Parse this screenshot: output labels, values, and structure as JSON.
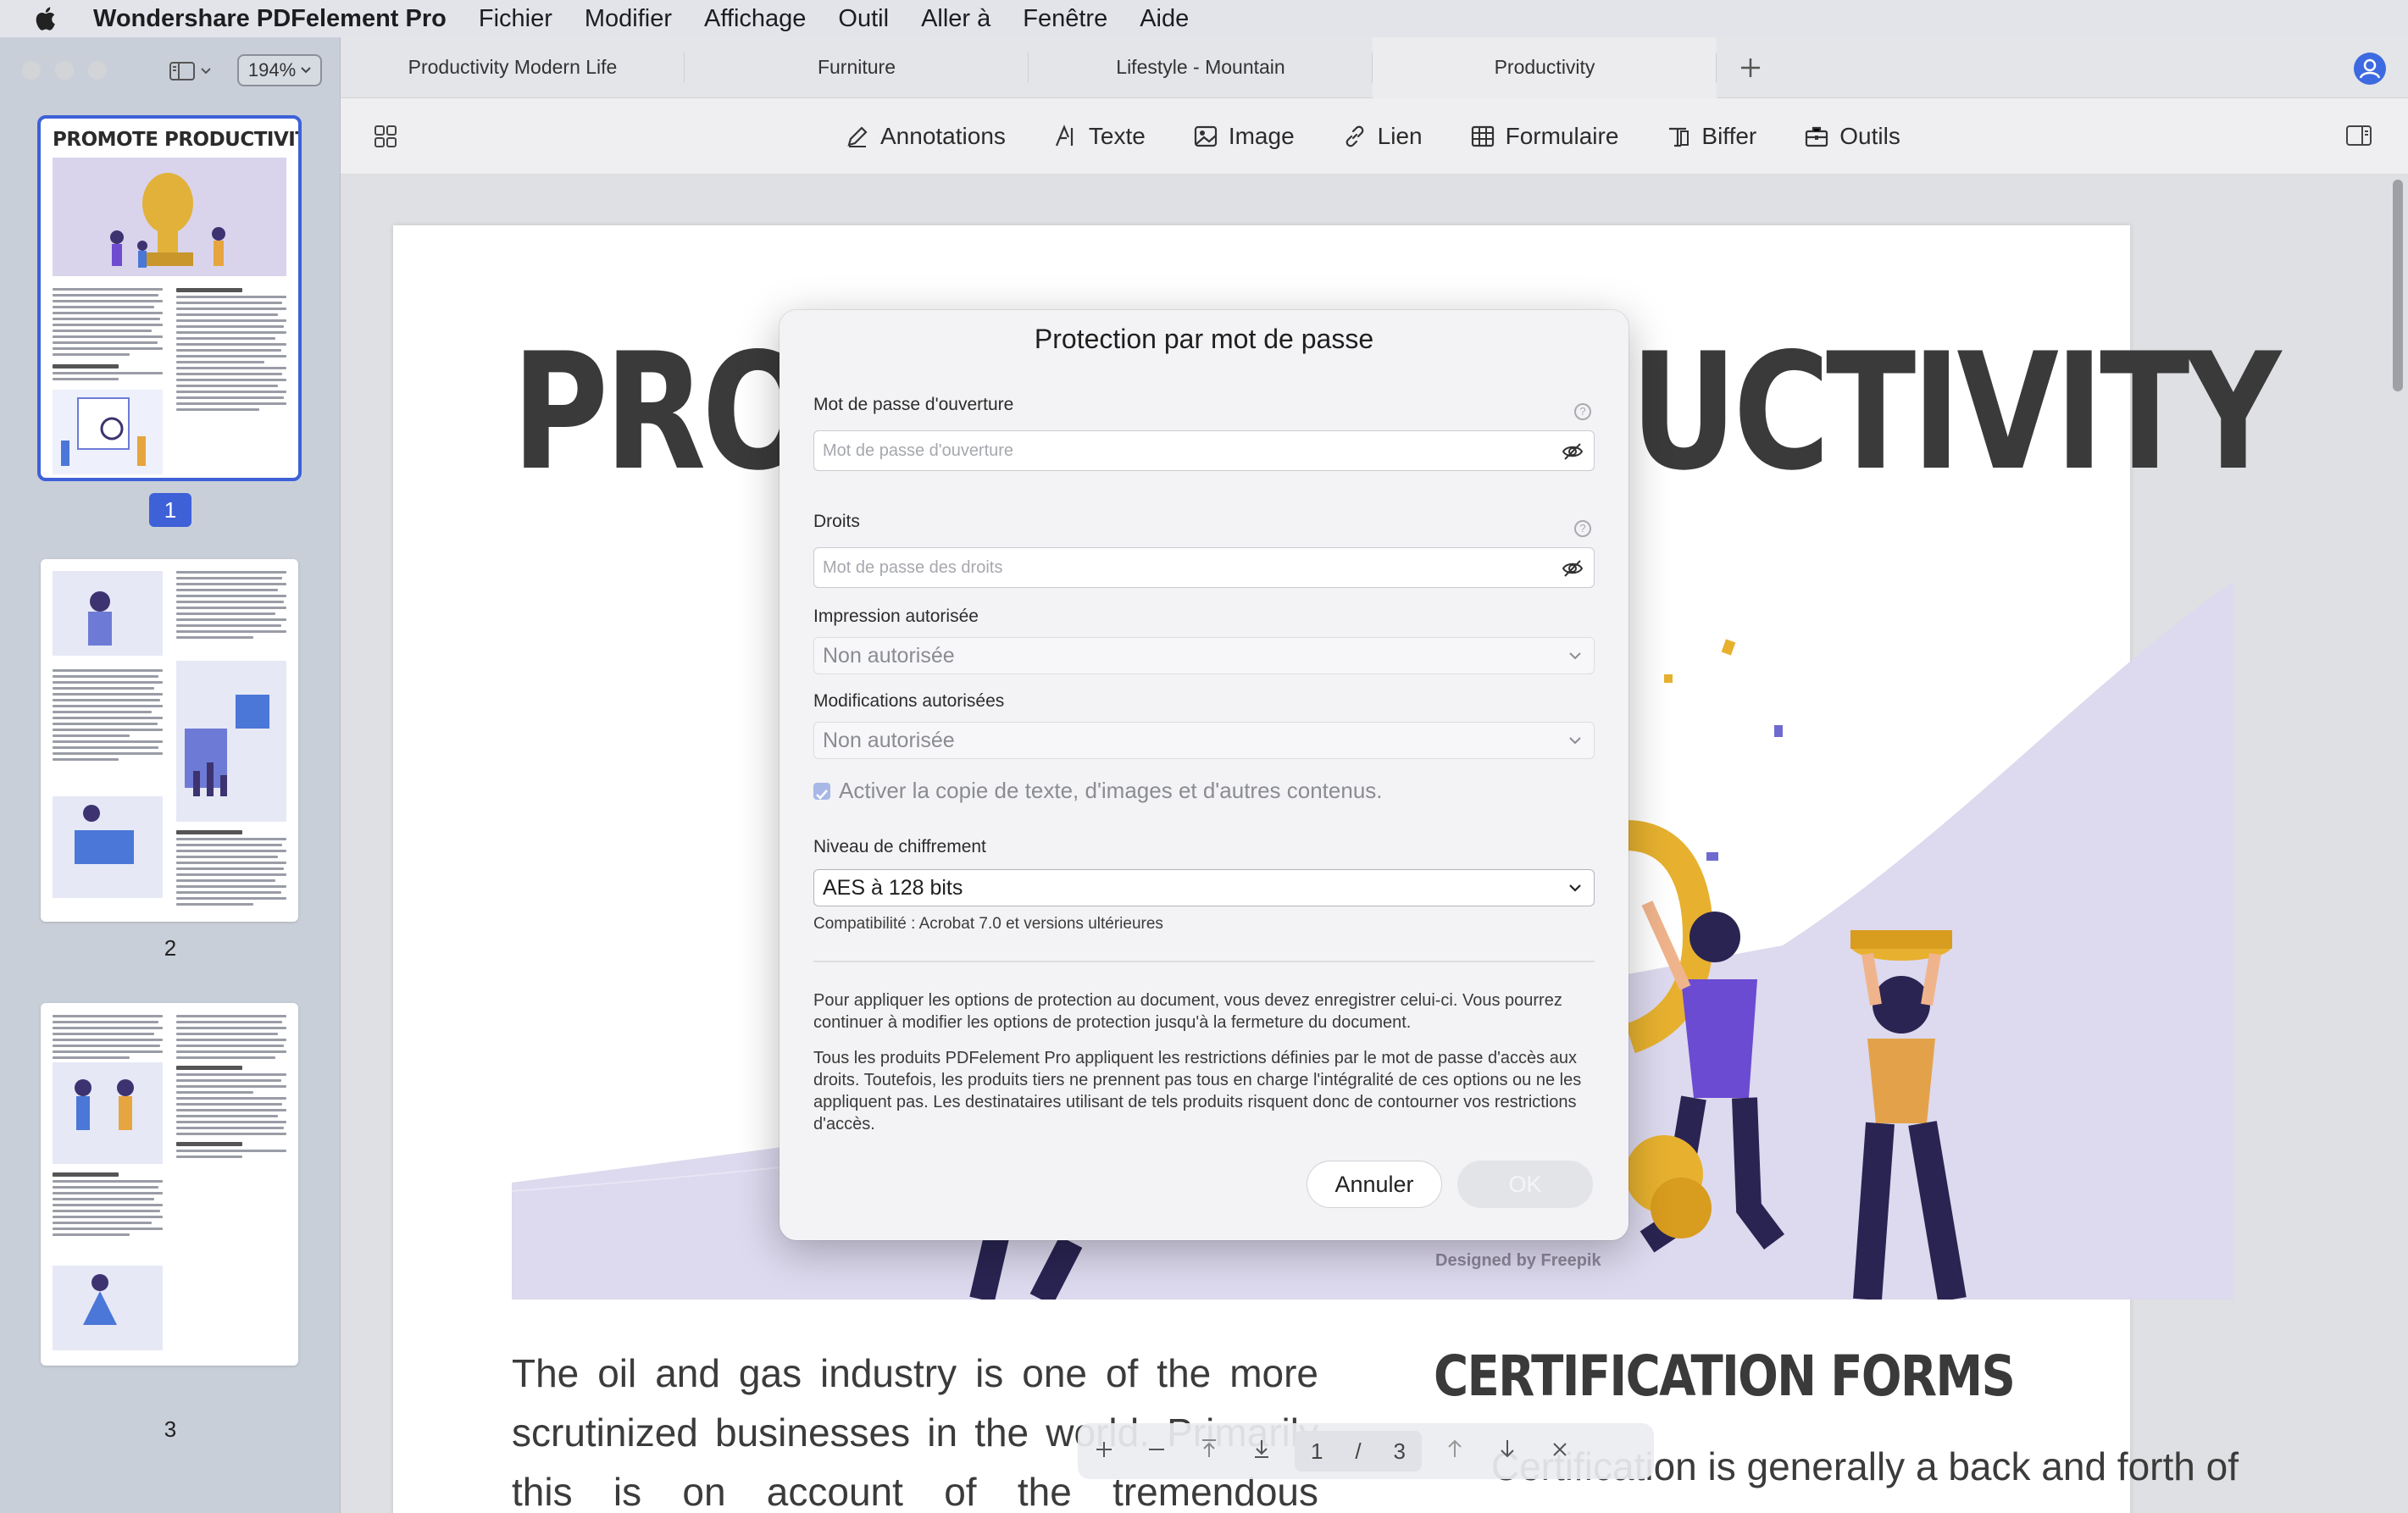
{
  "menubar": {
    "app_name": "Wondershare PDFelement Pro",
    "items": [
      "Fichier",
      "Modifier",
      "Affichage",
      "Outil",
      "Aller à",
      "Fenêtre",
      "Aide"
    ]
  },
  "sidebar": {
    "zoom": "194%",
    "thumbnails": [
      {
        "number": "1",
        "title": "PROMOTE PRODUCTIVITY",
        "selected": true
      },
      {
        "number": "2",
        "selected": false
      },
      {
        "number": "3",
        "selected": false
      }
    ]
  },
  "tabs": {
    "items": [
      "Productivity Modern Life",
      "Furniture",
      "Lifestyle - Mountain",
      "Productivity"
    ],
    "active_index": 3
  },
  "toolbar": {
    "items": [
      {
        "label": "Annotations",
        "icon": "pen-icon"
      },
      {
        "label": "Texte",
        "icon": "text-icon"
      },
      {
        "label": "Image",
        "icon": "image-icon"
      },
      {
        "label": "Lien",
        "icon": "link-icon"
      },
      {
        "label": "Formulaire",
        "icon": "table-icon"
      },
      {
        "label": "Biffer",
        "icon": "redact-icon"
      },
      {
        "label": "Outils",
        "icon": "toolbox-icon"
      }
    ]
  },
  "document": {
    "title_left": "PRO",
    "title_right": "UCTIVITY",
    "credit": "Designed by Freepik",
    "body_text": "The oil and gas industry is one of the more scrutinized businesses in the world. Primarily this is on account of the tremendous",
    "cert_title": "CERTIFICATION FORMS",
    "cert_text": "Certification is generally a back and forth of"
  },
  "pagenav": {
    "current": "1",
    "separator": "/",
    "total": "3"
  },
  "dialog": {
    "title": "Protection par mot de passe",
    "open_password_label": "Mot de passe d'ouverture",
    "open_password_placeholder": "Mot de passe d'ouverture",
    "rights_label": "Droits",
    "rights_placeholder": "Mot de passe des droits",
    "printing_label": "Impression autorisée",
    "printing_value": "Non autorisée",
    "changes_label": "Modifications autorisées",
    "changes_value": "Non autorisée",
    "copy_label": "Activer la copie de texte, d'images et d'autres contenus.",
    "encryption_label": "Niveau de chiffrement",
    "encryption_value": "AES à 128 bits",
    "compat": "Compatibilité : Acrobat 7.0 et versions ultérieures",
    "para1": "Pour appliquer les options de protection au document, vous devez enregistrer celui-ci. Vous pourrez continuer à modifier les options de protection jusqu'à la fermeture du document.",
    "para2": "Tous les produits PDFelement Pro appliquent les restrictions définies par le mot de passe d'accès aux droits. Toutefois, les produits tiers ne prennent pas tous en charge l'intégralité de ces options ou ne les appliquent pas. Les destinataires utilisant de tels produits risquent donc de contourner vos restrictions d'accès.",
    "cancel": "Annuler",
    "ok": "OK"
  }
}
